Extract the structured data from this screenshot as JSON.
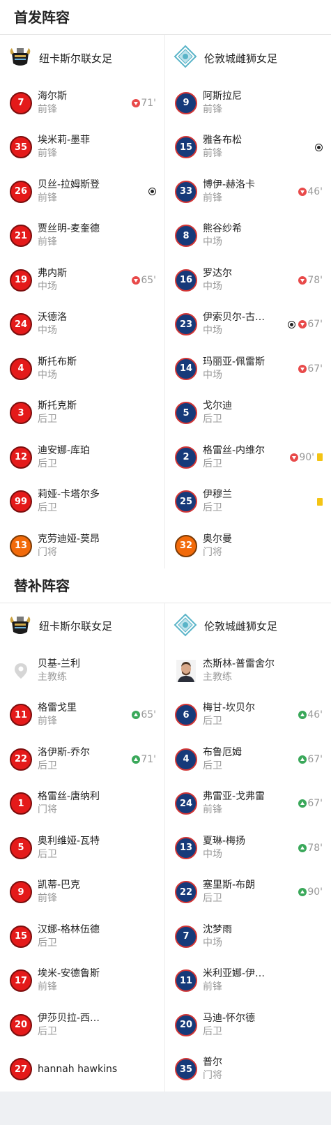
{
  "starting": {
    "title": "首发阵容",
    "home": {
      "team": "纽卡斯尔联女足",
      "players": [
        {
          "num": "7",
          "name": "海尔斯",
          "pos": "前锋",
          "color": "red",
          "events": [
            {
              "t": "out",
              "min": "71'"
            }
          ]
        },
        {
          "num": "35",
          "name": "埃米莉-墨菲",
          "pos": "前锋",
          "color": "red",
          "events": []
        },
        {
          "num": "26",
          "name": "贝丝-拉姆斯登",
          "pos": "前锋",
          "color": "red",
          "events": [
            {
              "t": "goal"
            }
          ]
        },
        {
          "num": "21",
          "name": "贾丝明-麦奎德",
          "pos": "前锋",
          "color": "red",
          "events": []
        },
        {
          "num": "19",
          "name": "弗内斯",
          "pos": "中场",
          "color": "red",
          "events": [
            {
              "t": "out",
              "min": "65'"
            }
          ]
        },
        {
          "num": "24",
          "name": "沃德洛",
          "pos": "中场",
          "color": "red",
          "events": []
        },
        {
          "num": "4",
          "name": "斯托布斯",
          "pos": "中场",
          "color": "red",
          "events": []
        },
        {
          "num": "3",
          "name": "斯托克斯",
          "pos": "后卫",
          "color": "red",
          "events": []
        },
        {
          "num": "12",
          "name": "迪安娜-库珀",
          "pos": "后卫",
          "color": "red",
          "events": []
        },
        {
          "num": "99",
          "name": "莉娅-卡塔尔多",
          "pos": "后卫",
          "color": "red",
          "events": []
        },
        {
          "num": "13",
          "name": "克劳迪娅-莫昂",
          "pos": "门将",
          "color": "orange",
          "events": []
        }
      ]
    },
    "away": {
      "team": "伦敦城雌狮女足",
      "players": [
        {
          "num": "9",
          "name": "阿斯拉尼",
          "pos": "前锋",
          "color": "blue",
          "events": []
        },
        {
          "num": "15",
          "name": "雅各布松",
          "pos": "前锋",
          "color": "blue",
          "events": [
            {
              "t": "goal"
            }
          ]
        },
        {
          "num": "33",
          "name": "博伊-赫洛卡",
          "pos": "前锋",
          "color": "blue",
          "events": [
            {
              "t": "out",
              "min": "46'"
            }
          ]
        },
        {
          "num": "8",
          "name": "熊谷纱希",
          "pos": "中场",
          "color": "blue",
          "events": []
        },
        {
          "num": "16",
          "name": "罗达尔",
          "pos": "中场",
          "color": "blue",
          "events": [
            {
              "t": "out",
              "min": "78'"
            }
          ]
        },
        {
          "num": "23",
          "name": "伊索贝尔-古…",
          "pos": "中场",
          "color": "blue",
          "events": [
            {
              "t": "goal"
            },
            {
              "t": "out",
              "min": "67'"
            }
          ]
        },
        {
          "num": "14",
          "name": "玛丽亚-佩雷斯",
          "pos": "中场",
          "color": "blue",
          "events": [
            {
              "t": "out",
              "min": "67'"
            }
          ]
        },
        {
          "num": "5",
          "name": "戈尔迪",
          "pos": "后卫",
          "color": "blue",
          "events": []
        },
        {
          "num": "2",
          "name": "格雷丝-内维尔",
          "pos": "后卫",
          "color": "blue",
          "events": [
            {
              "t": "out",
              "min": "90'"
            },
            {
              "t": "yellow"
            }
          ]
        },
        {
          "num": "25",
          "name": "伊穆兰",
          "pos": "后卫",
          "color": "blue",
          "events": [
            {
              "t": "yellow"
            }
          ]
        },
        {
          "num": "32",
          "name": "奥尔曼",
          "pos": "门将",
          "color": "orange",
          "events": []
        }
      ]
    }
  },
  "subs": {
    "title": "替补阵容",
    "home": {
      "team": "纽卡斯尔联女足",
      "coach": {
        "name": "贝基-兰利",
        "role": "主教练"
      },
      "players": [
        {
          "num": "11",
          "name": "格雷戈里",
          "pos": "前锋",
          "color": "red",
          "events": [
            {
              "t": "in",
              "min": "65'"
            }
          ]
        },
        {
          "num": "22",
          "name": "洛伊斯-乔尔",
          "pos": "后卫",
          "color": "red",
          "events": [
            {
              "t": "in",
              "min": "71'"
            }
          ]
        },
        {
          "num": "1",
          "name": "格雷丝-唐纳利",
          "pos": "门将",
          "color": "red",
          "events": []
        },
        {
          "num": "5",
          "name": "奥利维娅-瓦特",
          "pos": "后卫",
          "color": "red",
          "events": []
        },
        {
          "num": "9",
          "name": "凯蒂-巴克",
          "pos": "前锋",
          "color": "red",
          "events": []
        },
        {
          "num": "15",
          "name": "汉娜-格林伍德",
          "pos": "后卫",
          "color": "red",
          "events": []
        },
        {
          "num": "17",
          "name": "埃米-安德鲁斯",
          "pos": "前锋",
          "color": "red",
          "events": []
        },
        {
          "num": "20",
          "name": "伊莎贝拉-西…",
          "pos": "后卫",
          "color": "red",
          "events": []
        },
        {
          "num": "27",
          "name": "hannah hawkins",
          "pos": "",
          "color": "red",
          "events": []
        }
      ]
    },
    "away": {
      "team": "伦敦城雌狮女足",
      "coach": {
        "name": "杰斯林-普雷舍尔",
        "role": "主教练"
      },
      "players": [
        {
          "num": "6",
          "name": "梅甘-坎贝尔",
          "pos": "后卫",
          "color": "blue",
          "events": [
            {
              "t": "in",
              "min": "46'"
            }
          ]
        },
        {
          "num": "4",
          "name": "布鲁厄姆",
          "pos": "后卫",
          "color": "blue",
          "events": [
            {
              "t": "in",
              "min": "67'"
            }
          ]
        },
        {
          "num": "24",
          "name": "弗雷亚-戈弗雷",
          "pos": "前锋",
          "color": "blue",
          "events": [
            {
              "t": "in",
              "min": "67'"
            }
          ]
        },
        {
          "num": "13",
          "name": "夏琳-梅扬",
          "pos": "中场",
          "color": "blue",
          "events": [
            {
              "t": "in",
              "min": "78'"
            }
          ]
        },
        {
          "num": "22",
          "name": "塞里斯-布朗",
          "pos": "后卫",
          "color": "blue",
          "events": [
            {
              "t": "in",
              "min": "90'"
            }
          ]
        },
        {
          "num": "7",
          "name": "沈梦雨",
          "pos": "中场",
          "color": "blue",
          "events": []
        },
        {
          "num": "11",
          "name": "米利亚娜-伊…",
          "pos": "前锋",
          "color": "blue",
          "events": []
        },
        {
          "num": "20",
          "name": "马迪-怀尔德",
          "pos": "后卫",
          "color": "blue",
          "events": []
        },
        {
          "num": "35",
          "name": "普尔",
          "pos": "门将",
          "color": "blue",
          "events": []
        }
      ]
    }
  }
}
